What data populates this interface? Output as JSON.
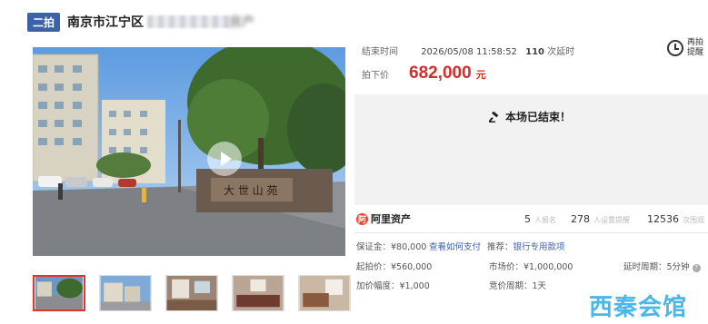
{
  "header": {
    "badge": "二拍",
    "title": "南京市江宁区",
    "title_suffix": "房产"
  },
  "auction": {
    "end_label": "结束时间",
    "end_time": "2026/05/08 11:58:52",
    "delay_count": "110",
    "delay_label": "次延时",
    "remind_label": "再拍提醒",
    "price_label": "拍下价",
    "price_value": "682,000",
    "price_unit": "元",
    "ended_message": "本场已结束！"
  },
  "platform": {
    "logo_text": "阿里资产",
    "applicants_value": "5",
    "applicants_label": "人报名",
    "reminders_value": "278",
    "reminders_label": "人设置提醒",
    "views_value": "12536",
    "views_label": "次围观"
  },
  "details": {
    "deposit_label": "保证金：",
    "deposit_value": "¥80,000",
    "pay_link": "查看如何支付",
    "recommend_label": "推荐：",
    "recommend_link": "银行专用款项",
    "start_label": "起拍价：",
    "start_value": "¥560,000",
    "market_label": "市场价：",
    "market_value": "¥1,000,000",
    "delay_period_label": "延时周期：",
    "delay_period_value": "5分钟",
    "increment_label": "加价幅度：",
    "increment_value": "¥1,000",
    "bid_period_label": "竞价周期：",
    "bid_period_value": "1天"
  },
  "watermark": "西秦会馆",
  "colors": {
    "badge": "#3a63a8",
    "price": "#d92b2b",
    "link": "#3a63a8",
    "watermark": "#37b0e6",
    "active_thumb_border": "#e1342a"
  }
}
